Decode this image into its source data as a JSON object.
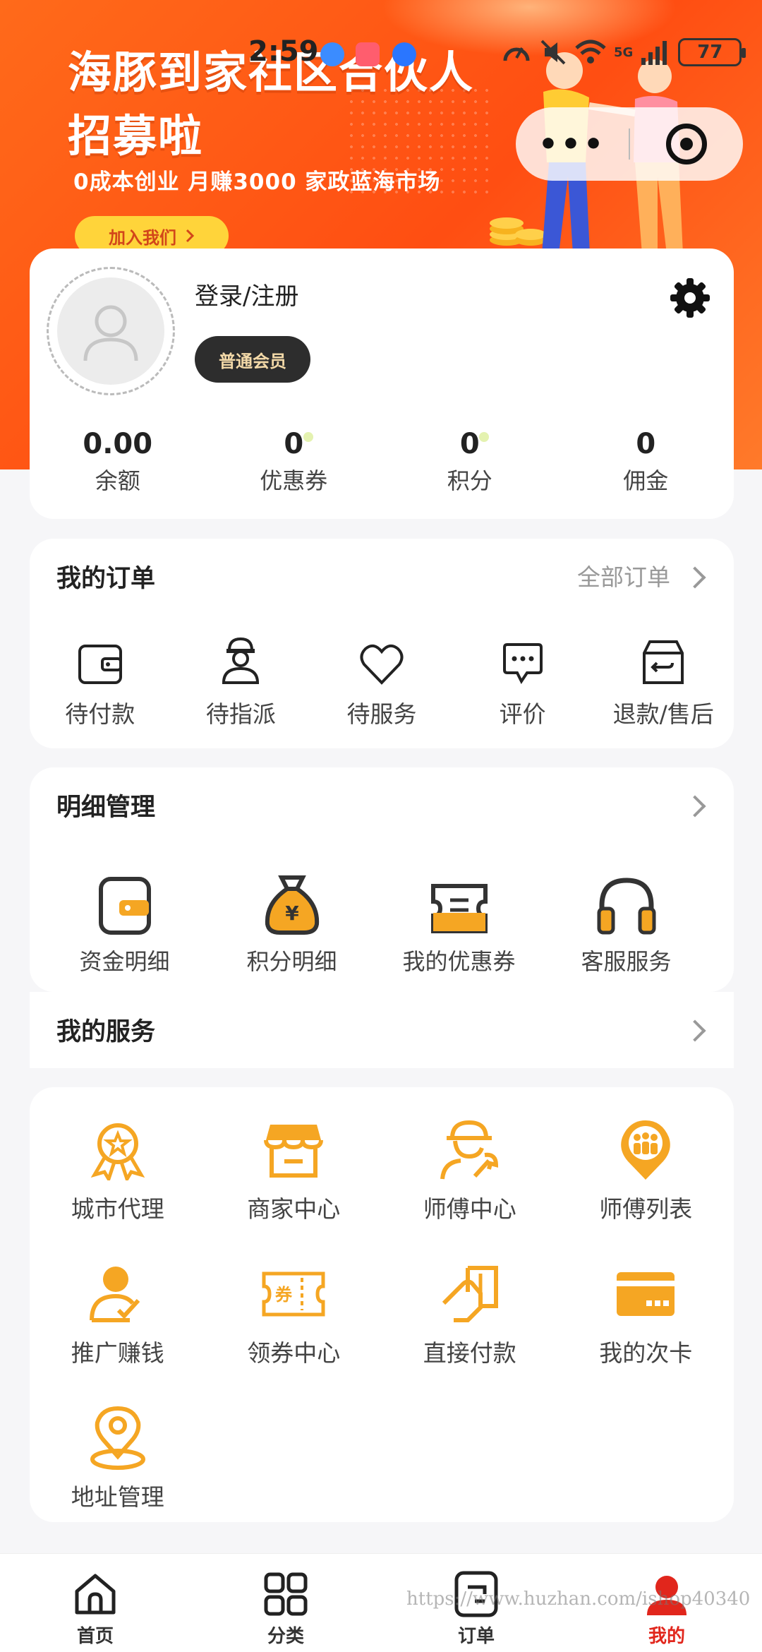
{
  "status_bar": {
    "time": "2:59",
    "battery": "77",
    "network": "5G"
  },
  "banner": {
    "title": "海豚到家社区合伙人招募啦",
    "subtitle": "0成本创业 月赚3000 家政蓝海市场",
    "join_label": "加入我们",
    "capsule_more": "•••"
  },
  "profile": {
    "login_label": "登录/注册",
    "member_level": "普通会员",
    "stats": [
      {
        "value": "0.00",
        "label": "余额"
      },
      {
        "value": "0",
        "label": "优惠券"
      },
      {
        "value": "0",
        "label": "积分"
      },
      {
        "value": "0",
        "label": "佣金"
      }
    ]
  },
  "orders": {
    "title": "我的订单",
    "all_label": "全部订单",
    "items": [
      {
        "label": "待付款",
        "icon": "wallet-icon"
      },
      {
        "label": "待指派",
        "icon": "worker-icon"
      },
      {
        "label": "待服务",
        "icon": "heart-icon"
      },
      {
        "label": "评价",
        "icon": "comment-icon"
      },
      {
        "label": "退款/售后",
        "icon": "refund-box-icon"
      }
    ]
  },
  "detail": {
    "title": "明细管理",
    "items": [
      {
        "label": "资金明细",
        "icon": "wallet-icon"
      },
      {
        "label": "积分明细",
        "icon": "money-bag-icon"
      },
      {
        "label": "我的优惠券",
        "icon": "coupon-icon"
      },
      {
        "label": "客服服务",
        "icon": "headphones-icon"
      }
    ]
  },
  "services": {
    "title": "我的服务",
    "items": [
      {
        "label": "城市代理",
        "icon": "medal-icon"
      },
      {
        "label": "商家中心",
        "icon": "store-icon"
      },
      {
        "label": "师傅中心",
        "icon": "technician-icon"
      },
      {
        "label": "师傅列表",
        "icon": "group-pin-icon"
      },
      {
        "label": "推广赚钱",
        "icon": "promote-user-icon"
      },
      {
        "label": "领券中心",
        "icon": "ticket-icon"
      },
      {
        "label": "直接付款",
        "icon": "pay-card-icon"
      },
      {
        "label": "我的次卡",
        "icon": "card-icon"
      },
      {
        "label": "地址管理",
        "icon": "location-pin-icon"
      }
    ]
  },
  "tabbar": {
    "items": [
      {
        "label": "首页",
        "icon": "home-icon"
      },
      {
        "label": "分类",
        "icon": "grid-icon"
      },
      {
        "label": "订单",
        "icon": "order-icon"
      },
      {
        "label": "我的",
        "icon": "profile-icon"
      }
    ],
    "active_index": 3
  },
  "colors": {
    "accent": "#ff5a14",
    "icon_orange": "#f5a623",
    "active_red": "#e1261c"
  },
  "watermark": "https://www.huzhan.com/ishop40340"
}
